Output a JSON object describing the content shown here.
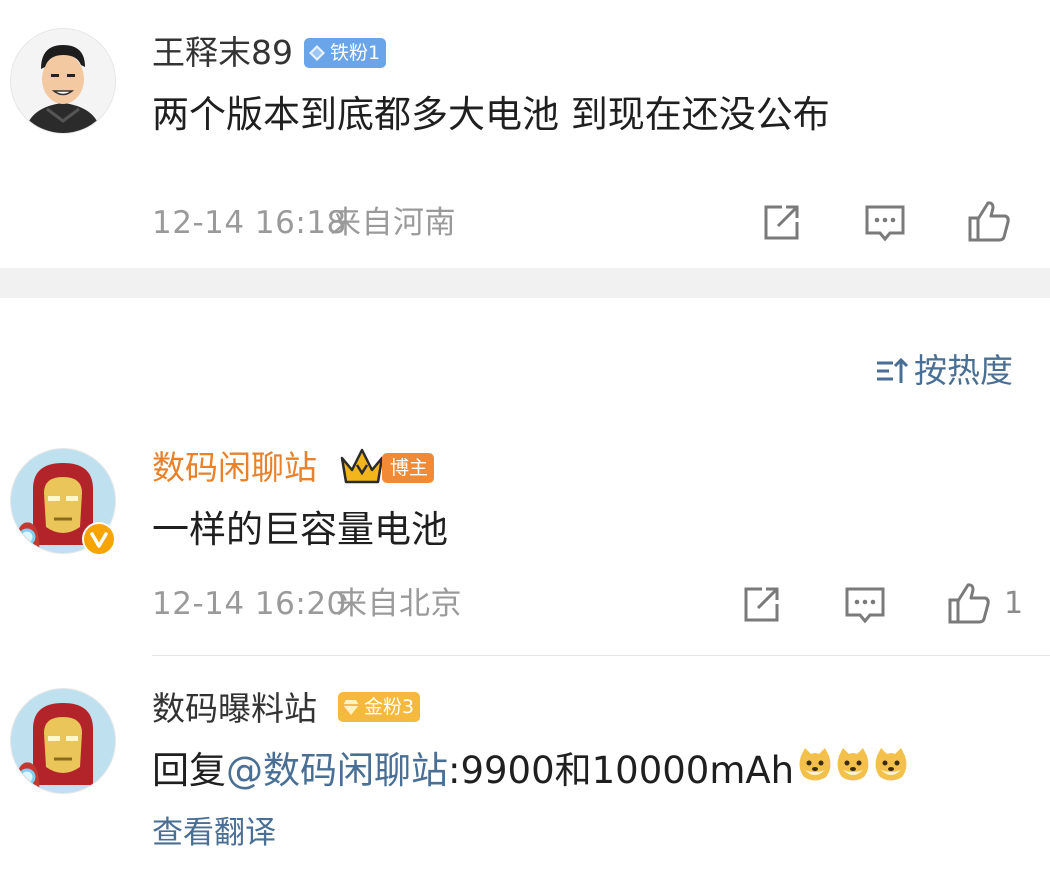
{
  "post": {
    "user": "王释末89",
    "badge": "铁粉1",
    "text": "两个版本到底都多大电池 到现在还没公布",
    "time": "12-14 16:18",
    "location": "来自河南",
    "actions": [
      "share-icon",
      "comment-icon",
      "like-icon"
    ]
  },
  "sort": {
    "label": "按热度",
    "icon": "sort-icon"
  },
  "comments": [
    {
      "user": "数码闲聊站",
      "name_color": "#e8812a",
      "badge": "博主",
      "badge_icon": "crown-icon",
      "verified_icon": "verified-v-icon",
      "text": "一样的巨容量电池",
      "time": "12-14 16:20",
      "location": "来自北京",
      "like_count": "1"
    },
    {
      "user": "数码曝料站",
      "badge": "金粉3",
      "reply_prefix": "回复",
      "mention": "@数码闲聊站",
      "reply_text": ":9900和10000mAh",
      "emojis": [
        "doge-emoji",
        "doge-emoji",
        "doge-emoji"
      ],
      "translate_label": "查看翻译"
    }
  ],
  "colors": {
    "link": "#4a6f95",
    "meta": "#9a9a9a",
    "badge_blue": "#6aa5ea",
    "badge_orange": "#f08a36",
    "badge_gold": "#f5b93e"
  }
}
